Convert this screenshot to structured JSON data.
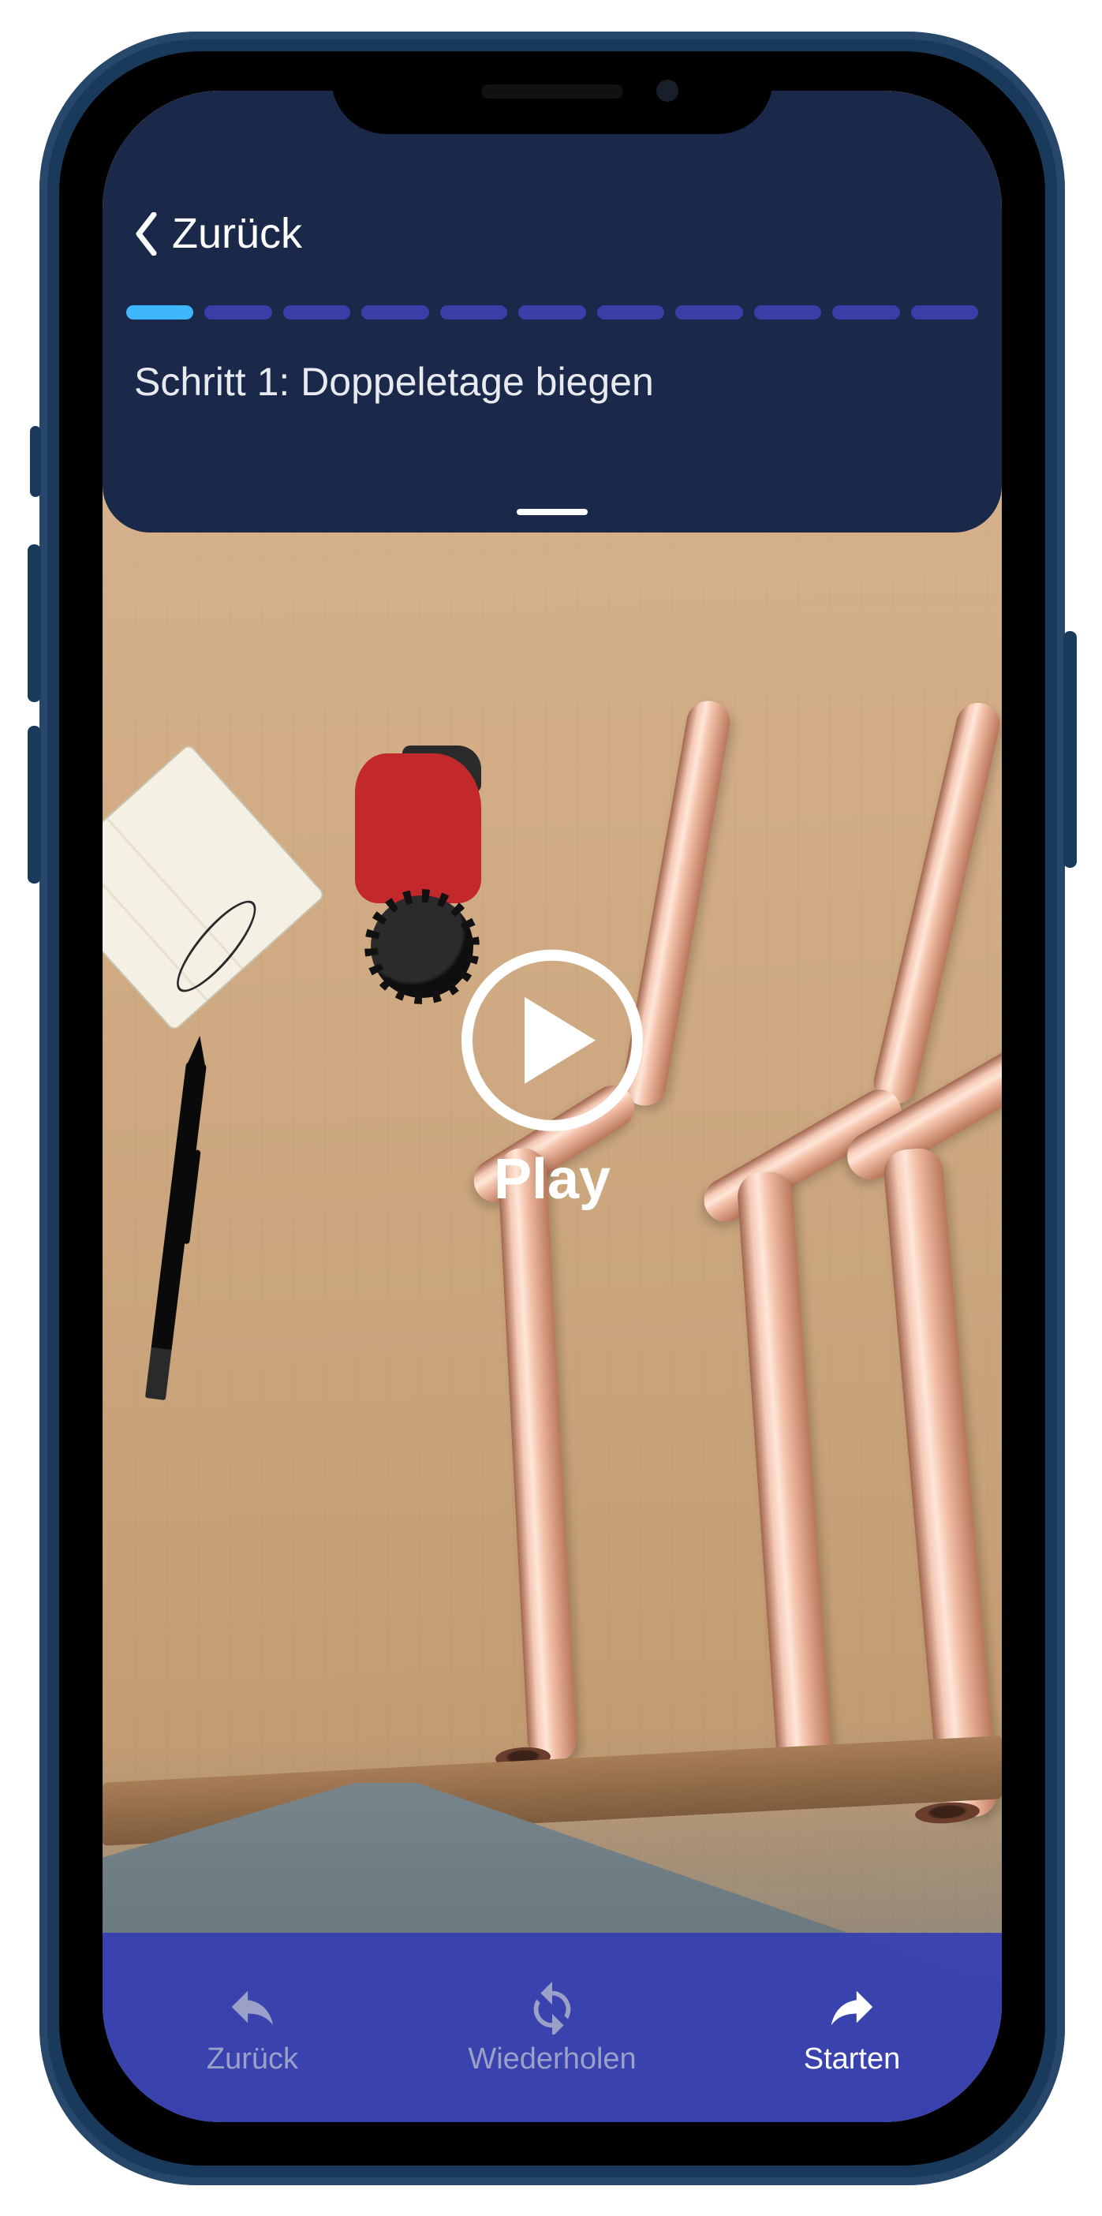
{
  "header": {
    "back_label": "Zurück",
    "step_title": "Schritt 1: Doppeletage biegen",
    "progress": {
      "total": 11,
      "current": 1
    }
  },
  "video": {
    "play_label": "Play"
  },
  "bottom_bar": {
    "items": [
      {
        "id": "back",
        "label": "Zurück",
        "icon": "reply-icon",
        "active": false
      },
      {
        "id": "repeat",
        "label": "Wiederholen",
        "icon": "reload-icon",
        "active": false
      },
      {
        "id": "start",
        "label": "Starten",
        "icon": "share-icon",
        "active": true
      }
    ]
  }
}
